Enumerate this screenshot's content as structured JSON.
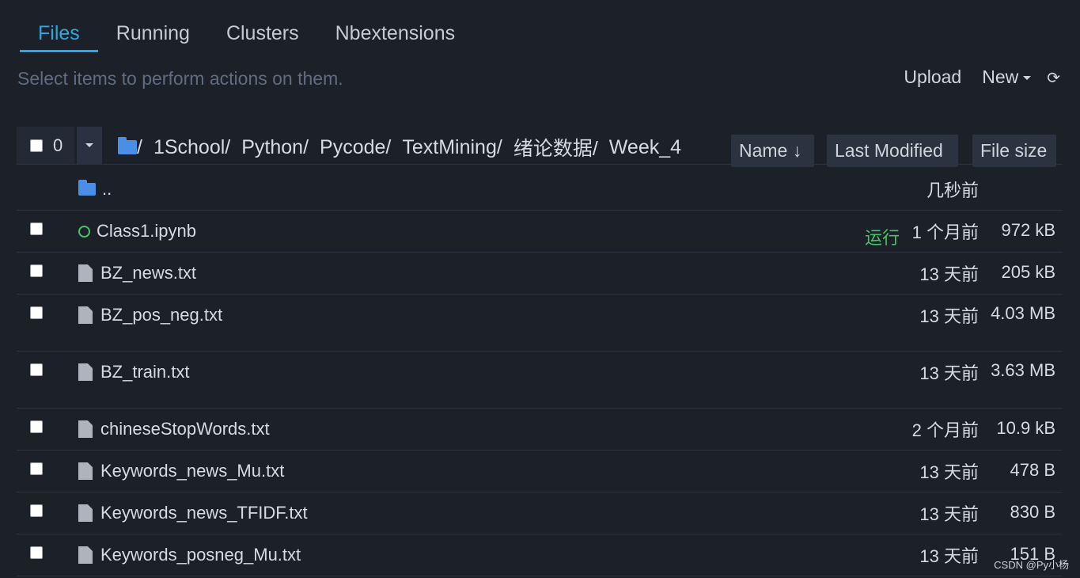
{
  "tabs": [
    "Files",
    "Running",
    "Clusters",
    "Nbextensions"
  ],
  "hint": "Select items to perform actions on them.",
  "actions": {
    "upload": "Upload",
    "new": "New",
    "refresh_icon": "refresh-icon"
  },
  "toolbar": {
    "selected_count": "0",
    "breadcrumb": [
      "/",
      "1School/",
      "Python/",
      "Pycode/",
      "TextMining/",
      "绪论数据/",
      "Week_4"
    ],
    "sort_name": "Name ↓",
    "sort_modified": "Last Modified",
    "sort_size": "File size"
  },
  "files": [
    {
      "name": "..",
      "type": "parent-folder",
      "modified": "几秒前",
      "size": ""
    },
    {
      "name": "Class1.ipynb",
      "type": "notebook",
      "status": "运行",
      "modified": "1 个月前",
      "size": "972 kB"
    },
    {
      "name": "BZ_news.txt",
      "type": "file",
      "modified": "13 天前",
      "size": "205 kB"
    },
    {
      "name": "BZ_pos_neg.txt",
      "type": "file",
      "modified": "13 天前",
      "size": "4.03 MB"
    },
    {
      "name": "BZ_train.txt",
      "type": "file",
      "modified": "13 天前",
      "size": "3.63 MB"
    },
    {
      "name": "chineseStopWords.txt",
      "type": "file",
      "modified": "2 个月前",
      "size": "10.9 kB"
    },
    {
      "name": "Keywords_news_Mu.txt",
      "type": "file",
      "modified": "13 天前",
      "size": "478 B"
    },
    {
      "name": "Keywords_news_TFIDF.txt",
      "type": "file",
      "modified": "13 天前",
      "size": "830 B"
    },
    {
      "name": "Keywords_posneg_Mu.txt",
      "type": "file",
      "modified": "13 天前",
      "size": "151 B"
    }
  ],
  "watermark": "CSDN @Py小杨",
  "colors": {
    "background": "#1c2029",
    "accent": "#2ea7e0",
    "running": "#4cc06a",
    "folder": "#4a8fe7"
  }
}
